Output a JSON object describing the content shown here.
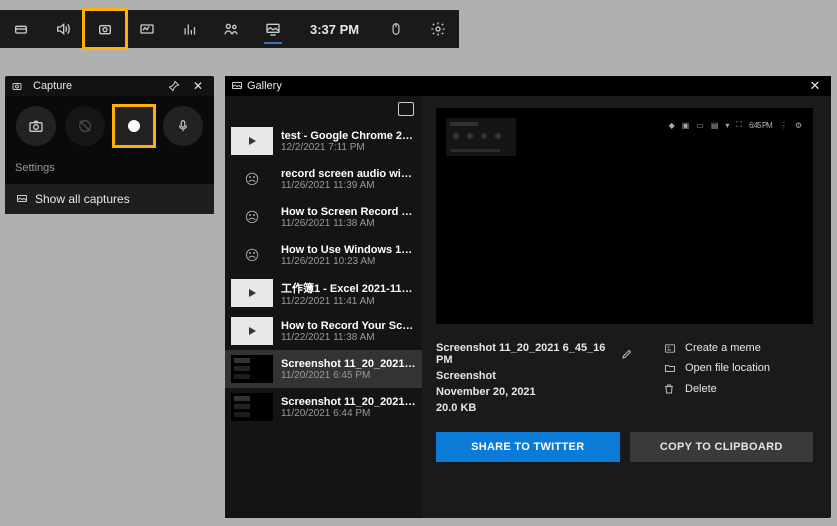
{
  "topbar": {
    "time": "3:37 PM"
  },
  "capture": {
    "title": "Capture",
    "settings_label": "Settings",
    "show_all_label": "Show all captures"
  },
  "gallery": {
    "title": "Gallery",
    "items": [
      {
        "title": "test - Google Chrome 2021-1...",
        "date": "12/2/2021 7:11 PM",
        "thumb": "light-play"
      },
      {
        "title": "record screen audio windo...",
        "date": "11/26/2021 11:39 AM",
        "thumb": "face"
      },
      {
        "title": "How to Screen Record on W...",
        "date": "11/26/2021 11:38 AM",
        "thumb": "face"
      },
      {
        "title": "How to Use Windows 10 Buil...",
        "date": "11/26/2021 10:23 AM",
        "thumb": "face"
      },
      {
        "title": "工作簿1 - Excel 2021-11-22 11...",
        "date": "11/22/2021 11:41 AM",
        "thumb": "light-play"
      },
      {
        "title": "How to Record Your Screen...",
        "date": "11/22/2021 11:38 AM",
        "thumb": "light-play"
      },
      {
        "title": "Screenshot 11_20_2021 6_45...",
        "date": "11/20/2021 6:45 PM",
        "thumb": "shot"
      },
      {
        "title": "Screenshot 11_20_2021 6_44...",
        "date": "11/20/2021 6:44 PM",
        "thumb": "shot"
      }
    ],
    "selected_index": 6,
    "preview": {
      "mini_time": "6:45 PM",
      "name": "Screenshot 11_20_2021 6_45_16 PM",
      "type": "Screenshot",
      "date": "November 20, 2021",
      "size": "20.0 KB"
    },
    "actions": {
      "meme": "Create a meme",
      "open": "Open file location",
      "delete": "Delete"
    },
    "buttons": {
      "share": "SHARE TO TWITTER",
      "copy": "COPY TO CLIPBOARD"
    }
  }
}
